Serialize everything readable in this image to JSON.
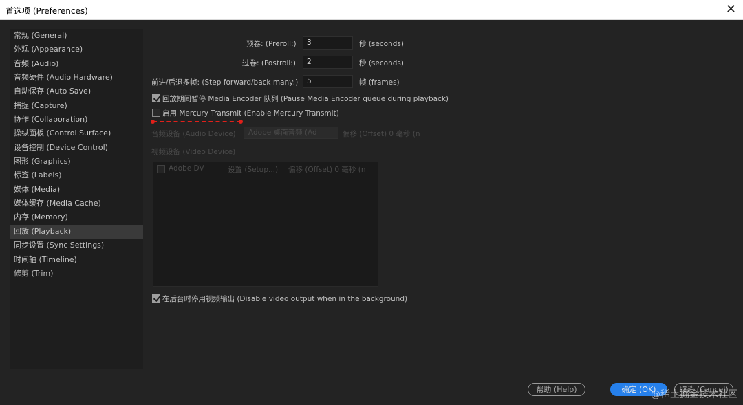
{
  "window": {
    "title": "首选项 (Preferences)"
  },
  "sidebar": {
    "items": [
      {
        "label": "常规 (General)"
      },
      {
        "label": "外观 (Appearance)"
      },
      {
        "label": "音频 (Audio)"
      },
      {
        "label": "音频硬件 (Audio Hardware)"
      },
      {
        "label": "自动保存 (Auto Save)"
      },
      {
        "label": "捕捉 (Capture)"
      },
      {
        "label": "协作 (Collaboration)"
      },
      {
        "label": "操纵面板 (Control Surface)"
      },
      {
        "label": "设备控制 (Device Control)"
      },
      {
        "label": "图形 (Graphics)"
      },
      {
        "label": "标签 (Labels)"
      },
      {
        "label": "媒体 (Media)"
      },
      {
        "label": "媒体缓存 (Media Cache)"
      },
      {
        "label": "内存 (Memory)"
      },
      {
        "label": "回放 (Playback)",
        "active": true
      },
      {
        "label": "同步设置 (Sync Settings)"
      },
      {
        "label": "时间轴 (Timeline)"
      },
      {
        "label": "修剪 (Trim)"
      }
    ]
  },
  "playback": {
    "preroll_label": "预卷: (Preroll:)",
    "preroll_value": "3",
    "preroll_unit": "秒 (seconds)",
    "postroll_label": "过卷: (Postroll:)",
    "postroll_value": "2",
    "postroll_unit": "秒 (seconds)",
    "step_label": "前进/后退多帧: (Step forward/back many:)",
    "step_value": "5",
    "step_unit": "帧 (frames)",
    "pause_me_label": "回放期间暂停 Media Encoder 队列 (Pause Media Encoder queue during playback)",
    "pause_me_checked": true,
    "mercury_label": "启用 Mercury Transmit (Enable Mercury Transmit)",
    "mercury_checked": false,
    "audio_device_label": "音频设备 (Audio Device)",
    "audio_device_value": "Adobe 桌面音频 (Ad",
    "audio_offset_label": "偏移 (Offset) 0 毫秒 (n",
    "video_device_label": "视频设备 (Video Device)",
    "video_devices": [
      {
        "name": "Adobe DV",
        "setup": "设置 (Setup...)",
        "offset": "偏移 (Offset) 0 毫秒 (n"
      }
    ],
    "bg_disable_label": "在后台时停用视频输出 (Disable video output when in the background)",
    "bg_disable_checked": true
  },
  "buttons": {
    "help": "帮助 (Help)",
    "ok": "确定 (OK)",
    "cancel": "取消 (Cancel)"
  },
  "watermark": "@稀土掘金技术社区",
  "colors": {
    "accent": "#2680eb",
    "annotation": "#e0201a"
  }
}
